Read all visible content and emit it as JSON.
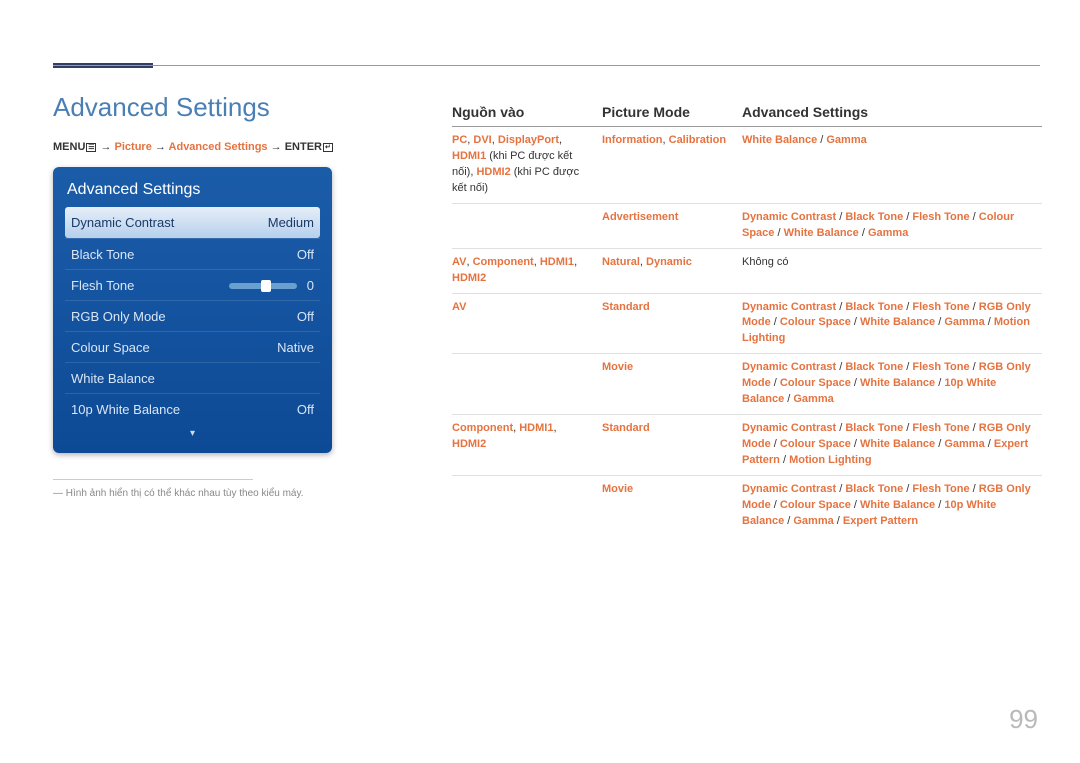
{
  "page": {
    "heading": "Advanced Settings",
    "page_number": "99",
    "footnote": "Hình ảnh hiển thị có thể khác nhau tùy theo kiểu máy."
  },
  "breadcrumb": {
    "menu": "MENU",
    "arrow": "→",
    "picture": "Picture",
    "adv": "Advanced Settings",
    "enter": "ENTER"
  },
  "osd": {
    "title": "Advanced Settings",
    "rows": [
      {
        "label": "Dynamic Contrast",
        "value": "Medium"
      },
      {
        "label": "Black Tone",
        "value": "Off"
      },
      {
        "label": "Flesh Tone",
        "value": "0"
      },
      {
        "label": "RGB Only Mode",
        "value": "Off"
      },
      {
        "label": "Colour Space",
        "value": "Native"
      },
      {
        "label": "White Balance",
        "value": ""
      },
      {
        "label": "10p White Balance",
        "value": "Off"
      }
    ]
  },
  "table": {
    "headers": {
      "c1": "Nguồn vào",
      "c2": "Picture Mode",
      "c3": "Advanced Settings"
    },
    "rows": [
      {
        "src_parts": [
          "PC",
          ", ",
          "DVI",
          ", ",
          "DisplayPort",
          ", ",
          "HDMI1",
          " (khi PC được kết nối), ",
          "HDMI2",
          " (khi PC được kết nối)"
        ],
        "mode_parts": [
          "Information",
          ", ",
          "Calibration"
        ],
        "adv_parts": [
          "White Balance",
          " / ",
          "Gamma"
        ]
      },
      {
        "src_parts": [
          ""
        ],
        "mode_parts": [
          "Advertisement"
        ],
        "adv_parts": [
          "Dynamic Contrast",
          " / ",
          "Black Tone",
          " / ",
          "Flesh Tone",
          " / ",
          "Colour Space",
          " / ",
          "White Balance",
          " / ",
          "Gamma"
        ]
      },
      {
        "src_parts": [
          "AV",
          ", ",
          "Component",
          ", ",
          "HDMI1",
          ", ",
          "HDMI2"
        ],
        "mode_parts": [
          "Natural",
          ", ",
          "Dynamic"
        ],
        "adv_plain": "Không có"
      },
      {
        "src_parts": [
          "AV"
        ],
        "mode_parts": [
          "Standard"
        ],
        "adv_parts": [
          "Dynamic Contrast",
          " / ",
          "Black Tone",
          " / ",
          "Flesh Tone",
          " / ",
          "RGB Only Mode",
          " / ",
          "Colour Space",
          " / ",
          "White Balance",
          " / ",
          "Gamma",
          " / ",
          "Motion Lighting"
        ]
      },
      {
        "src_parts": [
          ""
        ],
        "mode_parts": [
          "Movie"
        ],
        "adv_parts": [
          "Dynamic Contrast",
          " / ",
          "Black Tone",
          " / ",
          "Flesh Tone",
          " / ",
          "RGB Only Mode",
          " / ",
          "Colour Space",
          " / ",
          "White Balance",
          " / ",
          "10p White Balance",
          " / ",
          "Gamma"
        ]
      },
      {
        "src_parts": [
          "Component",
          ", ",
          "HDMI1",
          ", ",
          "HDMI2"
        ],
        "mode_parts": [
          "Standard"
        ],
        "adv_parts": [
          "Dynamic Contrast",
          " / ",
          "Black Tone",
          " / ",
          "Flesh Tone",
          " / ",
          "RGB Only Mode",
          " / ",
          "Colour Space",
          " / ",
          "White Balance",
          " / ",
          "Gamma",
          " / ",
          "Expert Pattern",
          " / ",
          "Motion Lighting"
        ]
      },
      {
        "src_parts": [
          ""
        ],
        "mode_parts": [
          "Movie"
        ],
        "adv_parts": [
          "Dynamic Contrast",
          " / ",
          "Black Tone",
          " / ",
          "Flesh Tone",
          " / ",
          "RGB Only Mode",
          " / ",
          "Colour Space",
          " / ",
          "White Balance",
          " / ",
          "10p White Balance",
          " / ",
          "Gamma",
          " / ",
          "Expert Pattern"
        ]
      }
    ]
  }
}
